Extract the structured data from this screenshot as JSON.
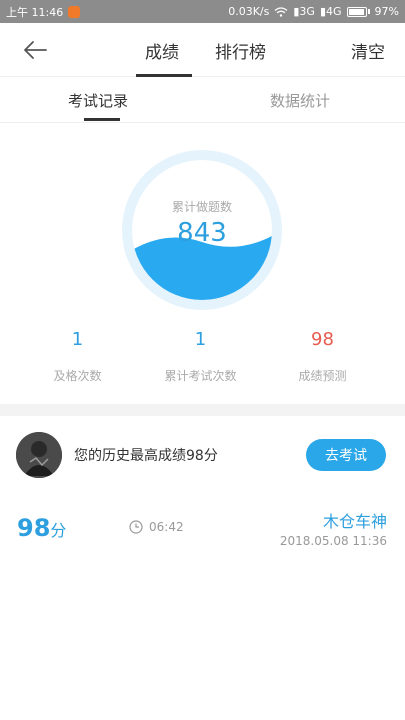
{
  "status_bar": {
    "time": "上午 11:46",
    "speed": "0.03K/s",
    "network1": "3G",
    "network2": "4G",
    "battery": "97%",
    "battery_level": 0.97
  },
  "header": {
    "tabs": [
      {
        "label": "成绩",
        "active": true
      },
      {
        "label": "排行榜",
        "active": false
      }
    ],
    "clear_label": "清空"
  },
  "subtabs": [
    {
      "label": "考试记录",
      "active": true
    },
    {
      "label": "数据统计",
      "active": false
    }
  ],
  "summary": {
    "ring_label": "累计做题数",
    "ring_value": "843",
    "metrics": [
      {
        "value": "1",
        "label": "及格次数",
        "color": "#2d9fdf"
      },
      {
        "value": "1",
        "label": "累计考试次数",
        "color": "#2d9fdf"
      },
      {
        "value": "98",
        "label": "成绩预测",
        "color": "#e85b50"
      }
    ]
  },
  "best": {
    "text": "您的历史最高成绩98分",
    "button_label": "去考试"
  },
  "records": [
    {
      "score": "98",
      "unit": "分",
      "duration": "06:42",
      "name": "木仓车神",
      "date": "2018.05.08  11:36"
    }
  ],
  "colors": {
    "accent": "#2d9fdf",
    "button": "#2aa7e8",
    "prediction": "#e85b50"
  }
}
